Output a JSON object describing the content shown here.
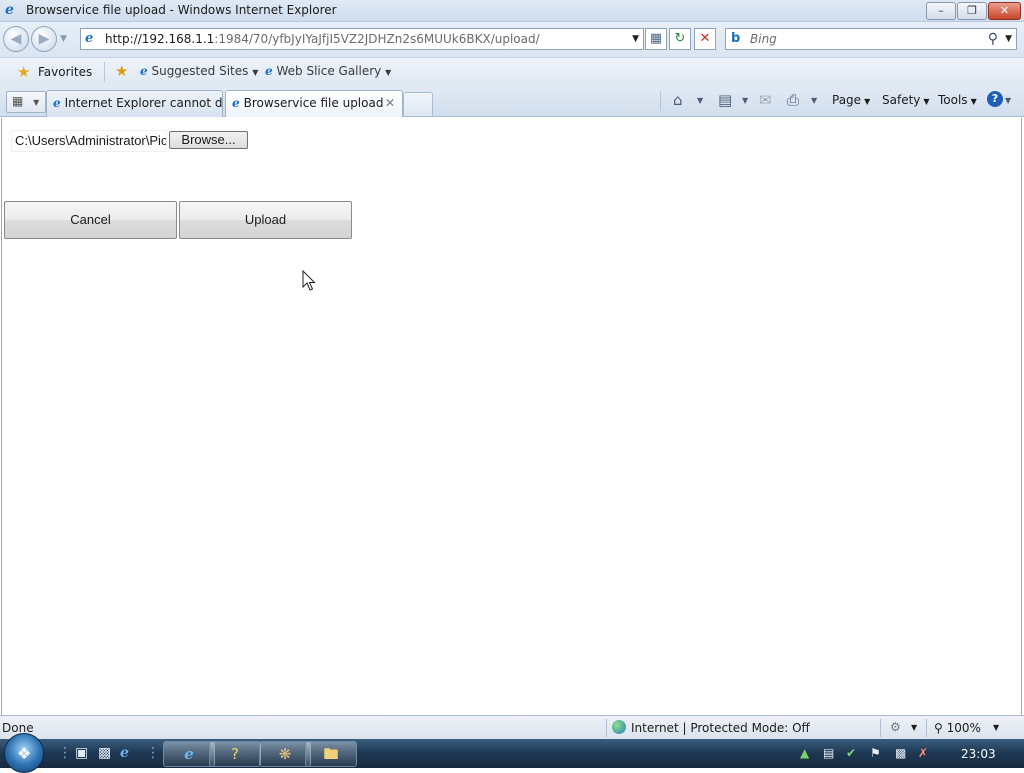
{
  "window": {
    "title": "Browservice file upload - Windows Internet Explorer",
    "controls": {
      "minimize": "–",
      "maximize": "❐",
      "close": "✕"
    }
  },
  "address_bar": {
    "url_host": "http://192.168.1.1",
    "url_rest": ":1984/70/yfbJyIYaJfjI5VZ2JDHZn2s6MUUk6BKX/upload/"
  },
  "search": {
    "placeholder": "Bing"
  },
  "favorites_bar": {
    "favorites_label": "Favorites",
    "items": [
      "Suggested Sites",
      "Web Slice Gallery"
    ]
  },
  "tabs": [
    {
      "label": "Internet Explorer cannot di...",
      "active": false
    },
    {
      "label": "Browservice file upload",
      "active": true
    }
  ],
  "command_bar": {
    "page": "Page",
    "safety": "Safety",
    "tools": "Tools"
  },
  "page": {
    "file_path": "C:\\Users\\Administrator\\Pictures",
    "browse_label": "Browse...",
    "cancel_label": "Cancel",
    "upload_label": "Upload"
  },
  "status_bar": {
    "status": "Done",
    "zone": "Internet | Protected Mode: Off",
    "zoom": "100%"
  },
  "taskbar": {
    "clock": "23:03"
  },
  "colors": {
    "chrome_blue": "#dae5f2",
    "taskbar": "#1f3a55",
    "ie_blue": "#1c6fc8"
  }
}
